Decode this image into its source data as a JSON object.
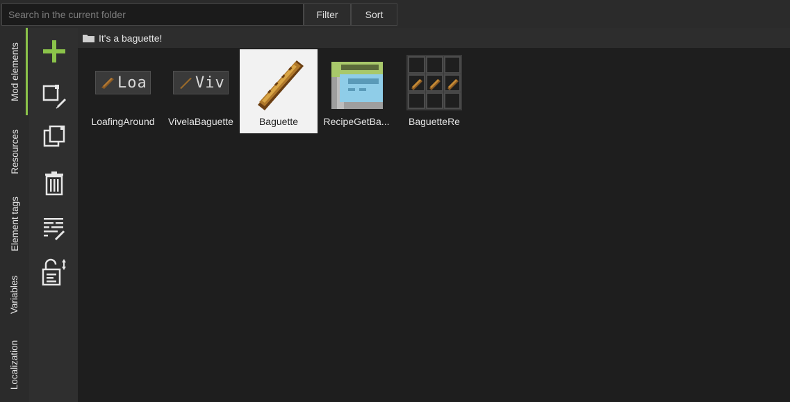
{
  "search": {
    "placeholder": "Search in the current folder"
  },
  "toolbar": {
    "filter_label": "Filter",
    "sort_label": "Sort"
  },
  "tabs": [
    {
      "label": "Mod elements",
      "active": true
    },
    {
      "label": "Resources",
      "active": false
    },
    {
      "label": "Element tags",
      "active": false
    },
    {
      "label": "Variables",
      "active": false
    },
    {
      "label": "Localization",
      "active": false
    }
  ],
  "tools": [
    {
      "icon": "plus-icon"
    },
    {
      "icon": "edit-element-icon"
    },
    {
      "icon": "duplicate-icon"
    },
    {
      "icon": "delete-icon"
    },
    {
      "icon": "edit-list-icon"
    },
    {
      "icon": "lock-code-icon"
    }
  ],
  "breadcrumb": {
    "folder_icon": "folder-icon",
    "path": "It's a baguette!"
  },
  "elements": [
    {
      "name": "LoafingAround",
      "tag": "Loa",
      "icon": "text-tag-icon",
      "selected": false
    },
    {
      "name": "VivelaBaguette",
      "tag": "Viv",
      "icon": "text-tag-icon",
      "selected": false
    },
    {
      "name": "Baguette",
      "icon": "baguette-item-icon",
      "selected": true
    },
    {
      "name": "RecipeGetBa...",
      "icon": "recipe-machine-icon",
      "selected": false
    },
    {
      "name": "BaguetteRe",
      "icon": "crafting-grid-icon",
      "selected": false
    }
  ],
  "colors": {
    "accent": "#8bc34a",
    "background": "#1e1e1e",
    "panel": "#2b2b2b",
    "selected": "#f2f2f2"
  }
}
